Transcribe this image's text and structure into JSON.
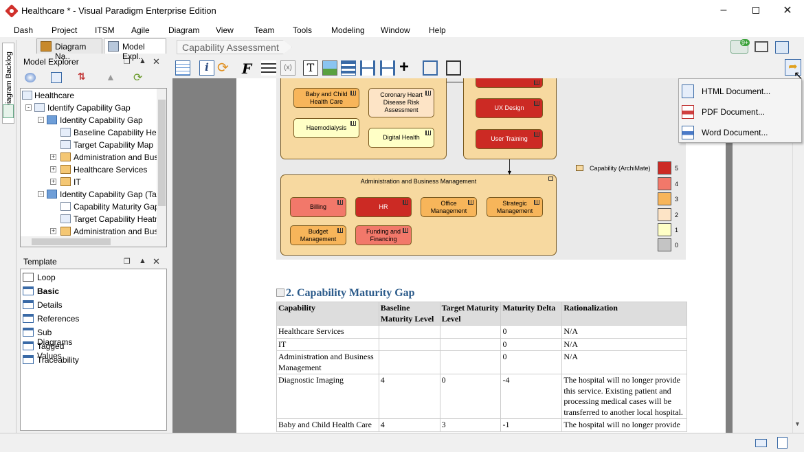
{
  "window": {
    "title": "Healthcare * - Visual Paradigm Enterprise Edition"
  },
  "menu": [
    "Dash",
    "Project",
    "ITSM",
    "Agile",
    "Diagram",
    "View",
    "Team",
    "Tools",
    "Modeling",
    "Window",
    "Help"
  ],
  "left_strip": {
    "label": "Diagram Backlog"
  },
  "tabs": [
    {
      "label": "Diagram Na.."
    },
    {
      "label": "Model Expl.."
    }
  ],
  "breadcrumb": "Capability Assessment",
  "notification_badge": "9+",
  "model_explorer": {
    "title": "Model Explorer",
    "tree": [
      "Healthcare",
      "Identify Capability Gap",
      "Identity Capability Gap",
      "Baseline Capability Heatm",
      "Target Capability Map",
      "Administration and Busin",
      "Healthcare Services",
      "IT",
      "Identity Capability Gap (Targe",
      "Capability Maturity Gap",
      "Target Capability Heatma",
      "Administration and Busin"
    ]
  },
  "template_panel": {
    "title": "Template",
    "items": [
      "Loop",
      "Basic",
      "Details",
      "References",
      "Sub Diagrams",
      "Tagged Values",
      "Traceability"
    ]
  },
  "export_menu": [
    "HTML Document...",
    "PDF Document...",
    "Word Document..."
  ],
  "diagram": {
    "top_left_boxes": [
      "Baby and Child Health Care",
      "Coronary Heart Disease Risk Assessment",
      "Haemodialysis",
      "Digital Health"
    ],
    "top_right_boxes": [
      "UX Design",
      "User Training"
    ],
    "admin_group": {
      "title": "Administration and Business Management",
      "boxes": [
        "Billing",
        "HR",
        "Office Management",
        "Strategic Management",
        "Budget Management",
        "Funding and Financing"
      ]
    },
    "legend": {
      "label": "Capability (ArchiMate)",
      "levels": [
        "5",
        "4",
        "3",
        "2",
        "1",
        "0"
      ],
      "colors": [
        "#cc2a24",
        "#f2786a",
        "#f7b55a",
        "#fde4c6",
        "#ffffc6",
        "#c4c4c4"
      ]
    }
  },
  "section": {
    "heading": "2. Capability Maturity Gap",
    "columns": [
      "Capability",
      "Baseline Maturity Level",
      "Target Maturity Level",
      "Maturity Delta",
      "Rationalization"
    ],
    "rows": [
      [
        "Healthcare Services",
        "",
        "",
        "0",
        "N/A"
      ],
      [
        "IT",
        "",
        "",
        "0",
        "N/A"
      ],
      [
        "Administration and Business Management",
        "",
        "",
        "0",
        "N/A"
      ],
      [
        "Diagnostic Imaging",
        "4",
        "0",
        "-4",
        "The hospital will no longer provide this service. Existing patient and processing medical cases will be transferred to another local hospital."
      ],
      [
        "Baby and Child Health Care",
        "4",
        "3",
        "-1",
        "The hospital will no longer provide"
      ]
    ]
  }
}
